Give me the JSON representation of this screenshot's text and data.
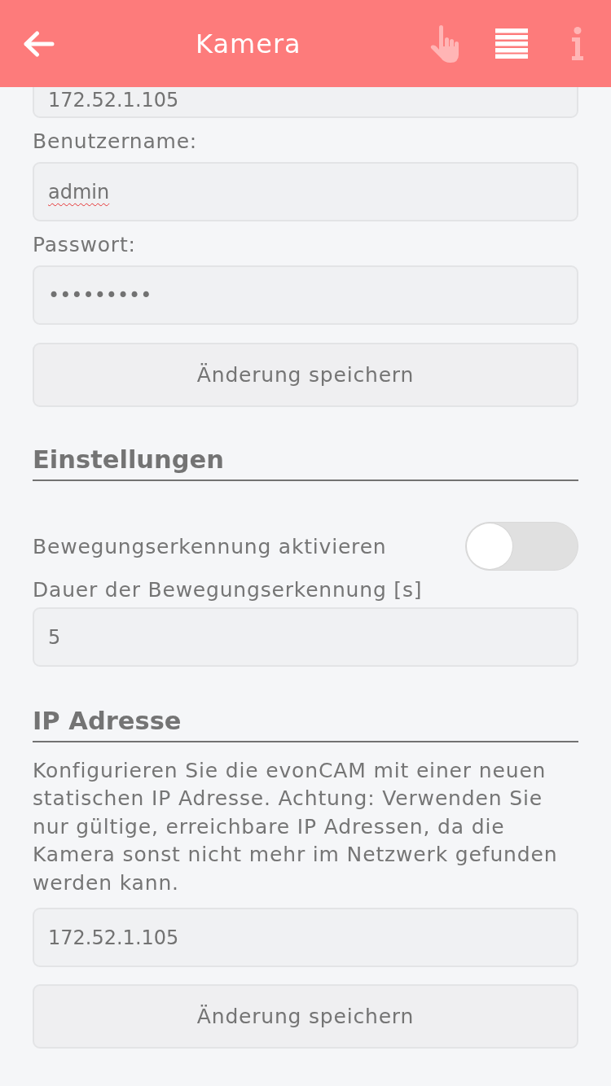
{
  "header": {
    "title": "Kamera",
    "actions": [
      {
        "kind": "hand",
        "disabled": true
      },
      {
        "kind": "list",
        "disabled": false
      },
      {
        "kind": "info",
        "disabled": true
      }
    ]
  },
  "camera_form": {
    "fields": [
      {
        "value": "172.52.1.105",
        "misspelled": false
      },
      {
        "label": "Benutzername:",
        "value": "admin",
        "misspelled": true
      },
      {
        "label": "Passwort:",
        "value": "•••••••••",
        "misspelled": false
      }
    ],
    "save_button": "Änderung speichern"
  },
  "settings": {
    "heading": "Einstellungen",
    "items": [
      {
        "kind": "toggle",
        "label": "Bewegungserkennung aktivieren",
        "on": false
      },
      {
        "kind": "number",
        "label": "Dauer der Bewegungserkennung [s]",
        "value": "5"
      }
    ]
  },
  "ip_address": {
    "heading": "IP Adresse",
    "description": "Konfigurieren Sie die evonCAM mit einer neuen statischen IP Adresse. Achtung: Verwenden Sie nur gültige, erreichbare IP Adressen, da die Kamera sonst nicht mehr im Netzwerk gefunden werden kann.",
    "value": "172.52.1.105",
    "save_button": "Änderung speichern"
  }
}
